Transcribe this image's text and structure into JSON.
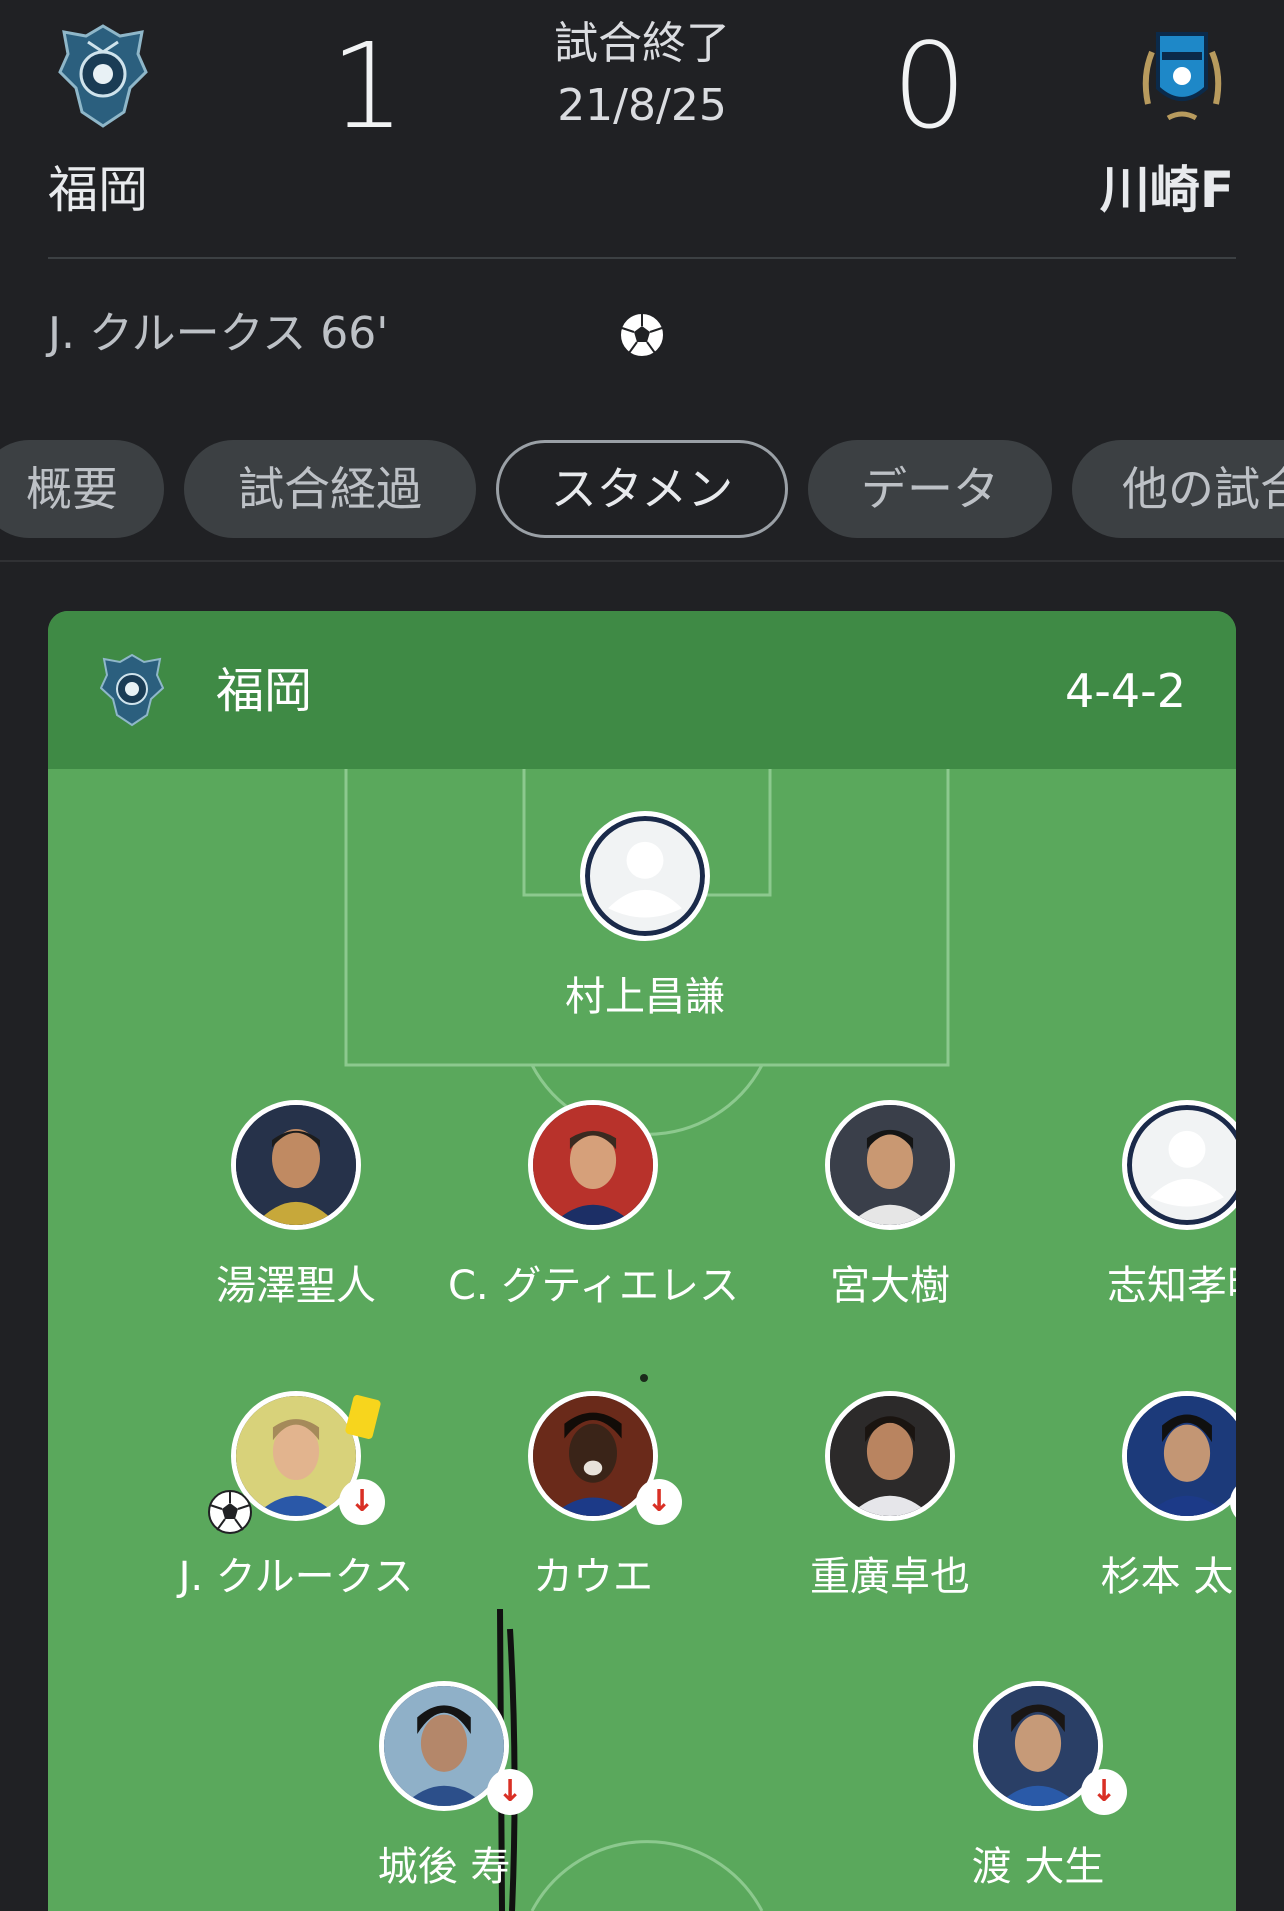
{
  "match": {
    "home": {
      "name": "福岡",
      "score": "1"
    },
    "away": {
      "name": "川崎F",
      "score": "0"
    },
    "status": "試合終了",
    "date": "21/8/25"
  },
  "goals": [
    {
      "text": "J. クルークス 66'",
      "icon": "soccer-ball-icon"
    }
  ],
  "tabs": [
    {
      "label": "概要",
      "active": false
    },
    {
      "label": "試合経過",
      "active": false
    },
    {
      "label": "スタメン",
      "active": true
    },
    {
      "label": "データ",
      "active": false
    },
    {
      "label": "他の試合",
      "active": false
    }
  ],
  "lineup": {
    "team": "福岡",
    "formation": "4-4-2",
    "players": [
      {
        "name": "村上昌謙",
        "photo": "placeholder-avatar-icon"
      },
      {
        "name": "湯澤聖人",
        "photo": "player-photo"
      },
      {
        "name": "C. グティエレス",
        "photo": "player-photo"
      },
      {
        "name": "宮大樹",
        "photo": "player-photo"
      },
      {
        "name": "志知孝明",
        "photo": "placeholder-avatar-icon"
      },
      {
        "name": "J. クルークス",
        "photo": "player-photo",
        "goal": true,
        "yellow_card": true,
        "substituted": true
      },
      {
        "name": "カウエ",
        "photo": "player-photo",
        "substituted": true
      },
      {
        "name": "重廣卓也",
        "photo": "player-photo"
      },
      {
        "name": "杉本 太郎",
        "photo": "player-photo",
        "substituted": true
      },
      {
        "name": "城後 寿",
        "photo": "player-photo",
        "substituted": true
      },
      {
        "name": "渡 大生",
        "photo": "player-photo",
        "substituted": true
      }
    ]
  },
  "colors": {
    "background": "#202124",
    "pitch": "#5aa85c",
    "pitch_header": "#3f8a45",
    "sub_arrow": "#d93025",
    "yellow_card": "#f7d51d"
  }
}
